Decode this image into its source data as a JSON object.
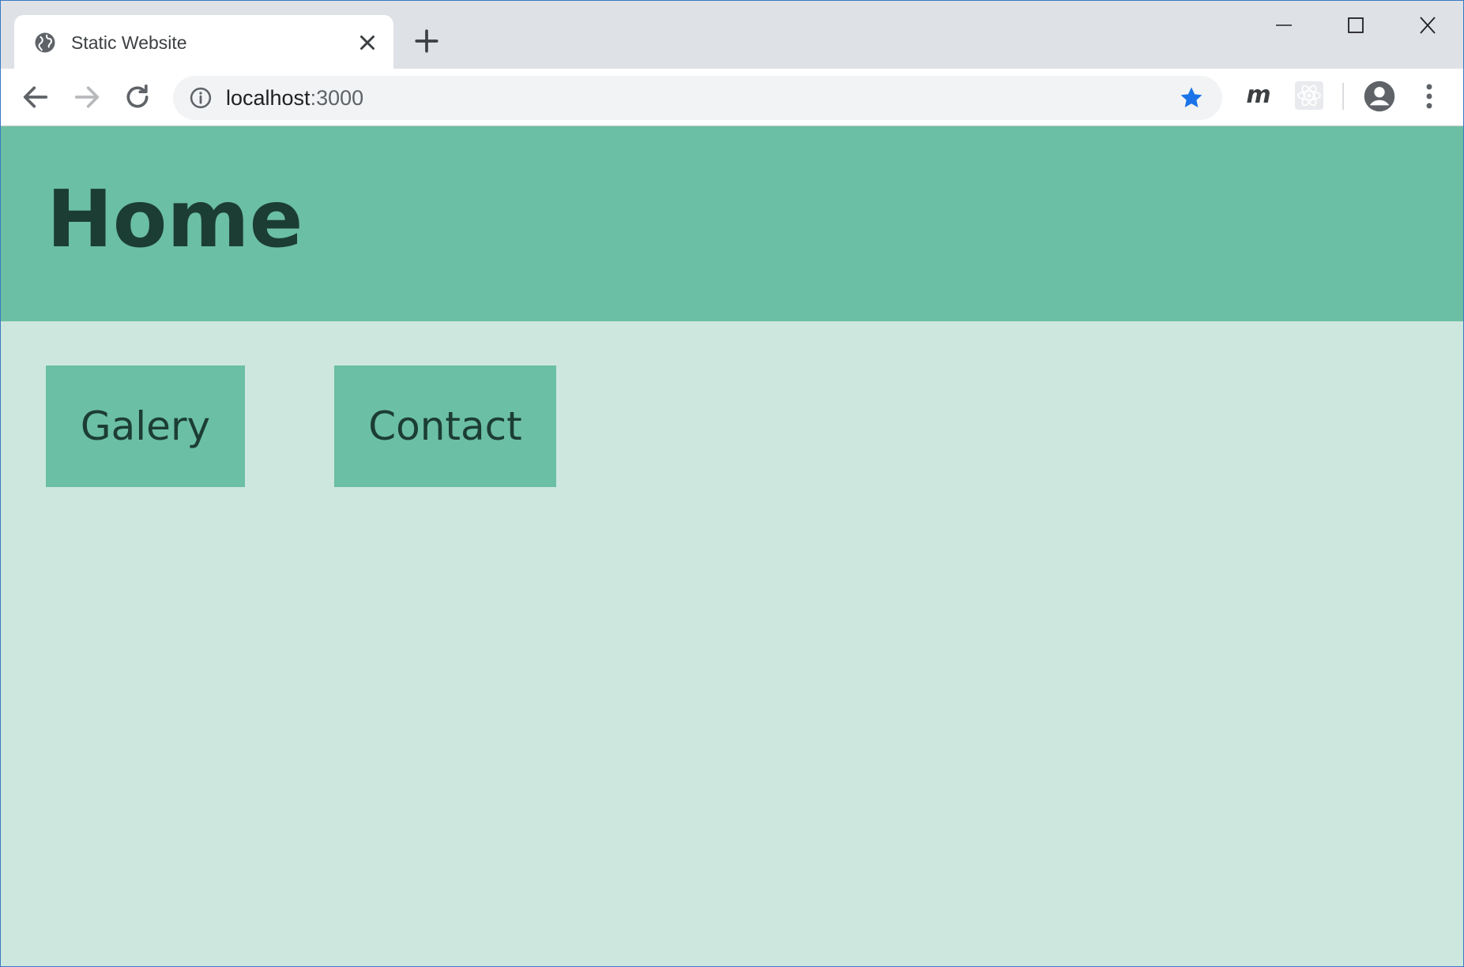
{
  "browser": {
    "tab": {
      "title": "Static Website",
      "favicon": "globe-icon",
      "close": "close-icon"
    },
    "new_tab": "plus-icon",
    "window_controls": [
      "minimize-icon",
      "maximize-icon",
      "close-icon"
    ],
    "toolbar": {
      "back": "back-arrow-icon",
      "forward": "forward-arrow-icon",
      "reload": "reload-icon",
      "url_host": "localhost",
      "url_port": ":3000",
      "bookmark_star": "star-icon",
      "bookmark_color": "#1a73e8",
      "extension_m_label": "m",
      "extension_react": "react-icon",
      "profile": "account-circle-icon",
      "menu": "more-vert-icon"
    }
  },
  "page": {
    "title": "Home",
    "links": [
      {
        "label": "Galery"
      },
      {
        "label": "Contact"
      }
    ],
    "colors": {
      "header_bg": "#6bbfa4",
      "body_bg": "#cde7de",
      "text": "#1c3d33",
      "button_bg": "#6bbfa4"
    }
  }
}
